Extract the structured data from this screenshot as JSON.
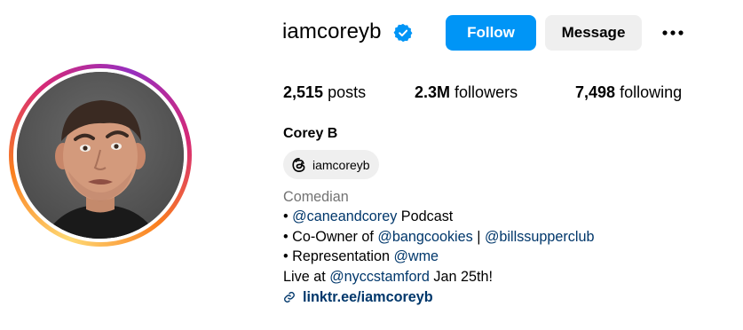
{
  "profile": {
    "username": "iamcoreyb",
    "full_name": "Corey B",
    "follow_label": "Follow",
    "message_label": "Message",
    "threads_handle": "iamcoreyb"
  },
  "stats": {
    "posts_count": "2,515",
    "posts_label": "posts",
    "followers_count": "2.3M",
    "followers_label": "followers",
    "following_count": "7,498",
    "following_label": "following"
  },
  "bio": {
    "category": "Comedian",
    "line1_bullet": "• ",
    "line1_mention": "@caneandcorey",
    "line1_suffix": " Podcast",
    "line2_prefix": "• Co-Owner of ",
    "line2_mention1": "@bangcookies",
    "line2_separator": " | ",
    "line2_mention2": "@billssupperclub",
    "line3_prefix": "• Representation ",
    "line3_mention": "@wme",
    "line4_prefix": "Live at ",
    "line4_mention": "@nyccstamford",
    "line4_suffix": " Jan 25th!",
    "link": "linktr.ee/iamcoreyb"
  },
  "colors": {
    "follow_blue": "#0095f6",
    "mention_blue": "#00376b",
    "secondary_gray": "#737373",
    "button_gray": "#efefef"
  },
  "icons": {
    "verified": "verified-badge-icon",
    "more": "more-options-icon",
    "threads": "threads-logo-icon",
    "link": "link-icon"
  }
}
